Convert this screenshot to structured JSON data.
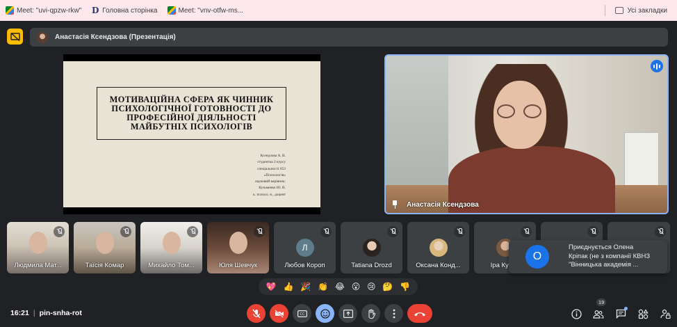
{
  "bookmarks": {
    "items": [
      {
        "icon": "google-meet-icon",
        "label": "Meet: \"uvi-qpzw-rkw\""
      },
      {
        "icon": "d-logo-icon",
        "label": "Головна сторінка"
      },
      {
        "icon": "google-meet-icon",
        "label": "Meet: \"vnv-otfw-ms..."
      }
    ],
    "all_label": "Усі закладки"
  },
  "presenting": {
    "label": "Анастасія Ксендзова (Презентація)"
  },
  "slide": {
    "title": "Мотиваційна сфера як чинник психологічної готовності до професійної діяльності майбутніх психологів",
    "info": [
      "Ксендзова А. В.",
      "студентка 2 курсу",
      "спеціальності 053",
      "«Психологія»",
      "науковий керівник:",
      "Кузьменко Ю. В.",
      "к. психол. н., доцент"
    ]
  },
  "speaker": {
    "name": "Анастасія Ксендзова"
  },
  "participants": [
    {
      "name": "Людмила Мат...",
      "video": true,
      "muted": true
    },
    {
      "name": "Таїсія Комар",
      "video": true,
      "muted": true
    },
    {
      "name": "Михайло Том...",
      "video": true,
      "muted": true
    },
    {
      "name": "Юля Шевчук",
      "video": true,
      "muted": true
    },
    {
      "name": "Любов Короп",
      "initial": "Л",
      "avatar_color": "#5f7c8a",
      "muted": true
    },
    {
      "name": "Tatiana Drozd",
      "initial": "",
      "avatar_color": "#c9c2ba",
      "muted": true
    },
    {
      "name": "Оксана Конд...",
      "initial": "",
      "avatar_color": "#e8d9c2",
      "muted": true
    },
    {
      "name": "Іра Кучер",
      "initial": "",
      "avatar_color": "#b89a7a",
      "muted": true
    }
  ],
  "toast": {
    "initial": "О",
    "lines": [
      "Приєднується Олена",
      "Кріпак (не з компанії КВНЗ",
      "\"Вінницька академія ..."
    ]
  },
  "reactions": [
    "💖",
    "👍",
    "🎉",
    "👏",
    "😂",
    "😮",
    "😢",
    "🤔",
    "👎"
  ],
  "bottom": {
    "time": "16:21",
    "separator": "|",
    "meeting_code": "pin-snha-rot",
    "people_count": "19"
  },
  "colors": {
    "accent": "#8ab4f8",
    "danger": "#ea4335",
    "present_yellow": "#fbbc04",
    "background": "#202124"
  }
}
